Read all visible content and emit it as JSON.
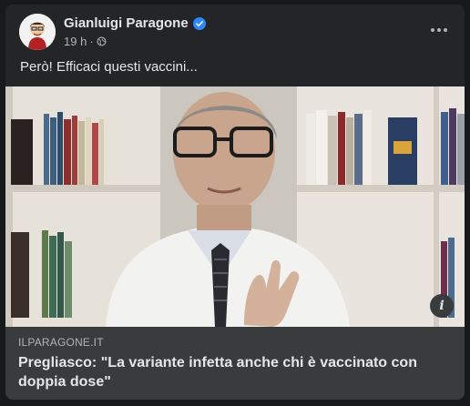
{
  "post": {
    "author": "Gianluigi Paragone",
    "time": "19 h",
    "separator": "·",
    "text": "Però! Efficaci questi vaccini..."
  },
  "link_preview": {
    "domain": "ILPARAGONE.IT",
    "headline": "Pregliasco: \"La variante infetta anche chi è vaccinato con doppia dose\""
  },
  "icons": {
    "verified": "verified-badge-icon",
    "audience": "globe-icon",
    "more": "more-options-icon",
    "info": "info-icon"
  },
  "colors": {
    "background": "#18191a",
    "card": "#242526",
    "link_box": "#3a3b3c",
    "verified": "#2d88ff",
    "primary_text": "#e4e6eb",
    "secondary_text": "#b0b3b8"
  }
}
